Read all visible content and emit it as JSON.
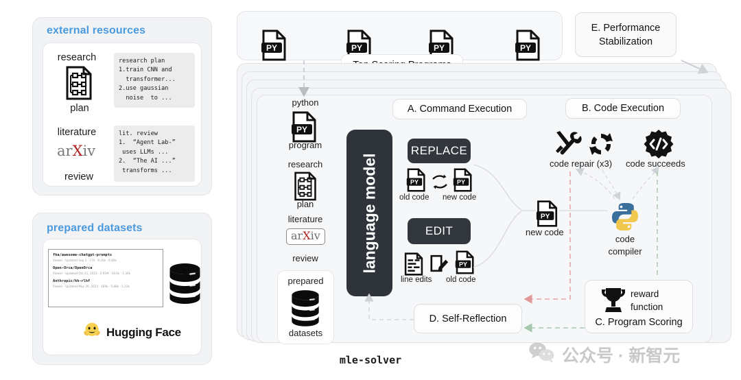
{
  "figure": {
    "caption": "mle-solver"
  },
  "left": {
    "external": {
      "title": "external resources",
      "research_label_top": "research",
      "research_label_bottom": "plan",
      "research_icon": "document-flowchart-icon",
      "research_text": "research plan\n1.train CNN and\n  transformer...\n2.use gaussian\n  noise  to ...",
      "literature_label_top": "literature",
      "literature_label_bottom": "review",
      "arxiv_logo": "arxiv-logo",
      "literature_text": "lit. review\n1.  “Agent Lab-”\n uses LLMs ...\n2.  “The AI ...”\n transforms ..."
    },
    "datasets": {
      "title": "prepared datasets",
      "brand": "Hugging Face",
      "brand_icon": "hugging-face-emoji",
      "database_icon": "database-stack-icon",
      "rows": [
        {
          "name": "fka/awesome-chatgpt-prompts",
          "meta": "Viewer · Updated Sep 3 · 170 · 9.24k · 6.40k"
        },
        {
          "name": "Open-Orca/OpenOrca",
          "meta": "Viewer · Updated Oct 21, 2023 · 2.91M · 18.6k · 1.34k"
        },
        {
          "name": "Anthropic/hh-rlhf",
          "meta": "Viewer · Updated May 26, 2023 · 169k · 5.88k · 1.22k"
        }
      ]
    }
  },
  "solver": {
    "programs": {
      "label": "Top Scoring Programs",
      "icons": [
        "py-file-icon",
        "py-file-icon",
        "py-file-icon",
        "py-file-icon"
      ],
      "count": 4
    },
    "performance_stabilization": {
      "label": "E. Performance\nStabilization",
      "line1": "E. Performance",
      "line2": "Stabilization"
    },
    "inputs": {
      "python_top": "python",
      "python_bottom": "program",
      "python_icon": "py-file-icon",
      "research_top": "research",
      "research_bottom": "plan",
      "research_icon": "document-flowchart-icon",
      "literature_top": "literature",
      "literature_bottom": "review",
      "literature_icon": "arxiv-logo",
      "datasets_top": "prepared",
      "datasets_bottom": "datasets",
      "datasets_icon": "database-stack-icon"
    },
    "language_model": {
      "label": "language model"
    },
    "command_execution": {
      "pill": "A. Command Execution",
      "replace": {
        "button": "REPLACE",
        "old_code": "old code",
        "new_code": "new code",
        "swap_icon": "swap-arrows-icon",
        "old_icon": "py-file-icon",
        "new_icon": "py-file-icon"
      },
      "edit": {
        "button": "EDIT",
        "line_edits": "line edits",
        "old_code": "old code",
        "lines_icon": "code-lines-icon",
        "pencil_icon": "pencil-square-icon",
        "old_icon": "py-file-icon"
      }
    },
    "new_code": {
      "label": "new code",
      "icon": "py-file-icon"
    },
    "code_execution": {
      "pill": "B. Code Execution",
      "repair": {
        "label": "code repair (x3)",
        "tools_icon": "wrench-screwdriver-icon",
        "refresh_icon": "refresh-circular-icon"
      },
      "succeeds": {
        "label": "code succeeds",
        "icon": "code-gear-icon"
      },
      "compiler": {
        "line1": "code",
        "line2": "compiler",
        "icon": "python-logo-icon"
      }
    },
    "program_scoring": {
      "caption": "C. Program Scoring",
      "reward_line1": "reward",
      "reward_line2": "function",
      "icon": "trophy-icon"
    },
    "self_reflection": {
      "pill": "D. Self-Reflection"
    }
  },
  "watermark": {
    "text": "公众号 · 新智元",
    "icon": "wechat-icon"
  },
  "colors": {
    "accent_blue": "#4a9ae0",
    "dark_block": "#2f343a",
    "panel_bg": "#f2f3f5",
    "stack_bg": "#f4f5f6",
    "repair_dash": "#e8a6a6",
    "success_dash": "#a8cdb0",
    "python_blue": "#3c6f9e",
    "python_yellow": "#f2cb4c",
    "arxiv_red": "#b3201f"
  }
}
